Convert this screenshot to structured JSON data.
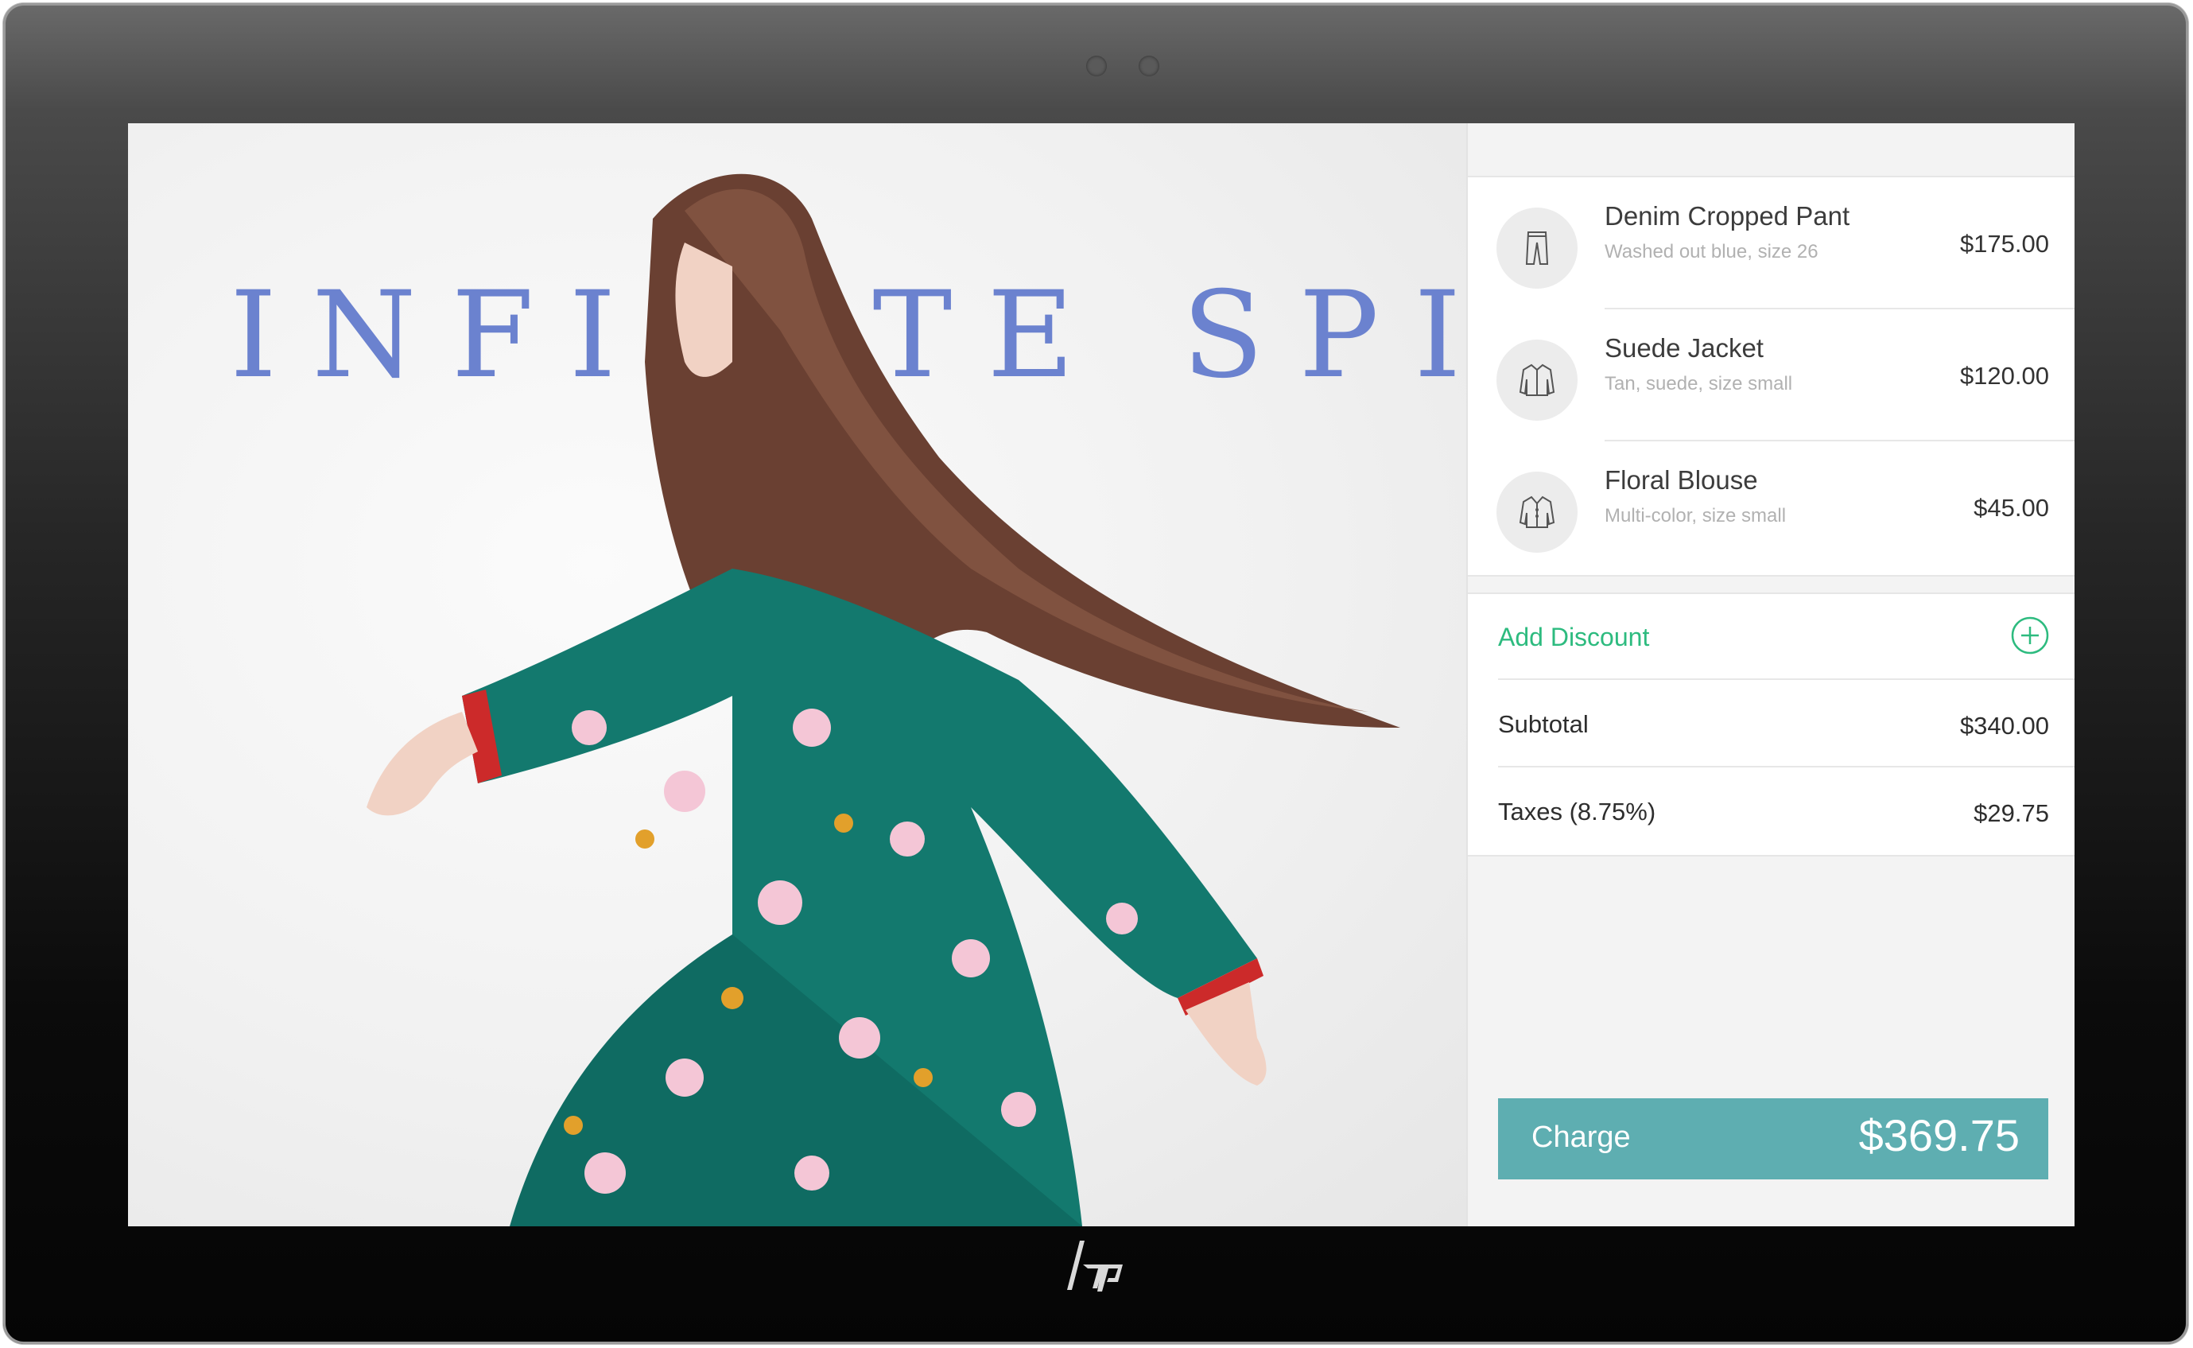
{
  "hero": {
    "title": "INFINITE SPIRIT"
  },
  "cart": {
    "items": [
      {
        "name": "Denim Cropped Pant",
        "description": "Washed out blue, size 26",
        "price": "$175.00",
        "icon": "pants-icon"
      },
      {
        "name": "Suede Jacket",
        "description": "Tan, suede, size small",
        "price": "$120.00",
        "icon": "jacket-icon"
      },
      {
        "name": "Floral Blouse",
        "description": "Multi-color, size small",
        "price": "$45.00",
        "icon": "blouse-icon"
      }
    ],
    "add_discount_label": "Add Discount",
    "subtotal_label": "Subtotal",
    "subtotal_value": "$340.00",
    "taxes_label": "Taxes (8.75%)",
    "taxes_value": "$29.75",
    "charge_label": "Charge",
    "charge_amount": "$369.75"
  },
  "colors": {
    "accent_green": "#2dbb7f",
    "charge_button": "#5eaeb1",
    "hero_title": "#6b82cf"
  },
  "device": {
    "brand_logo": "hp-logo"
  }
}
